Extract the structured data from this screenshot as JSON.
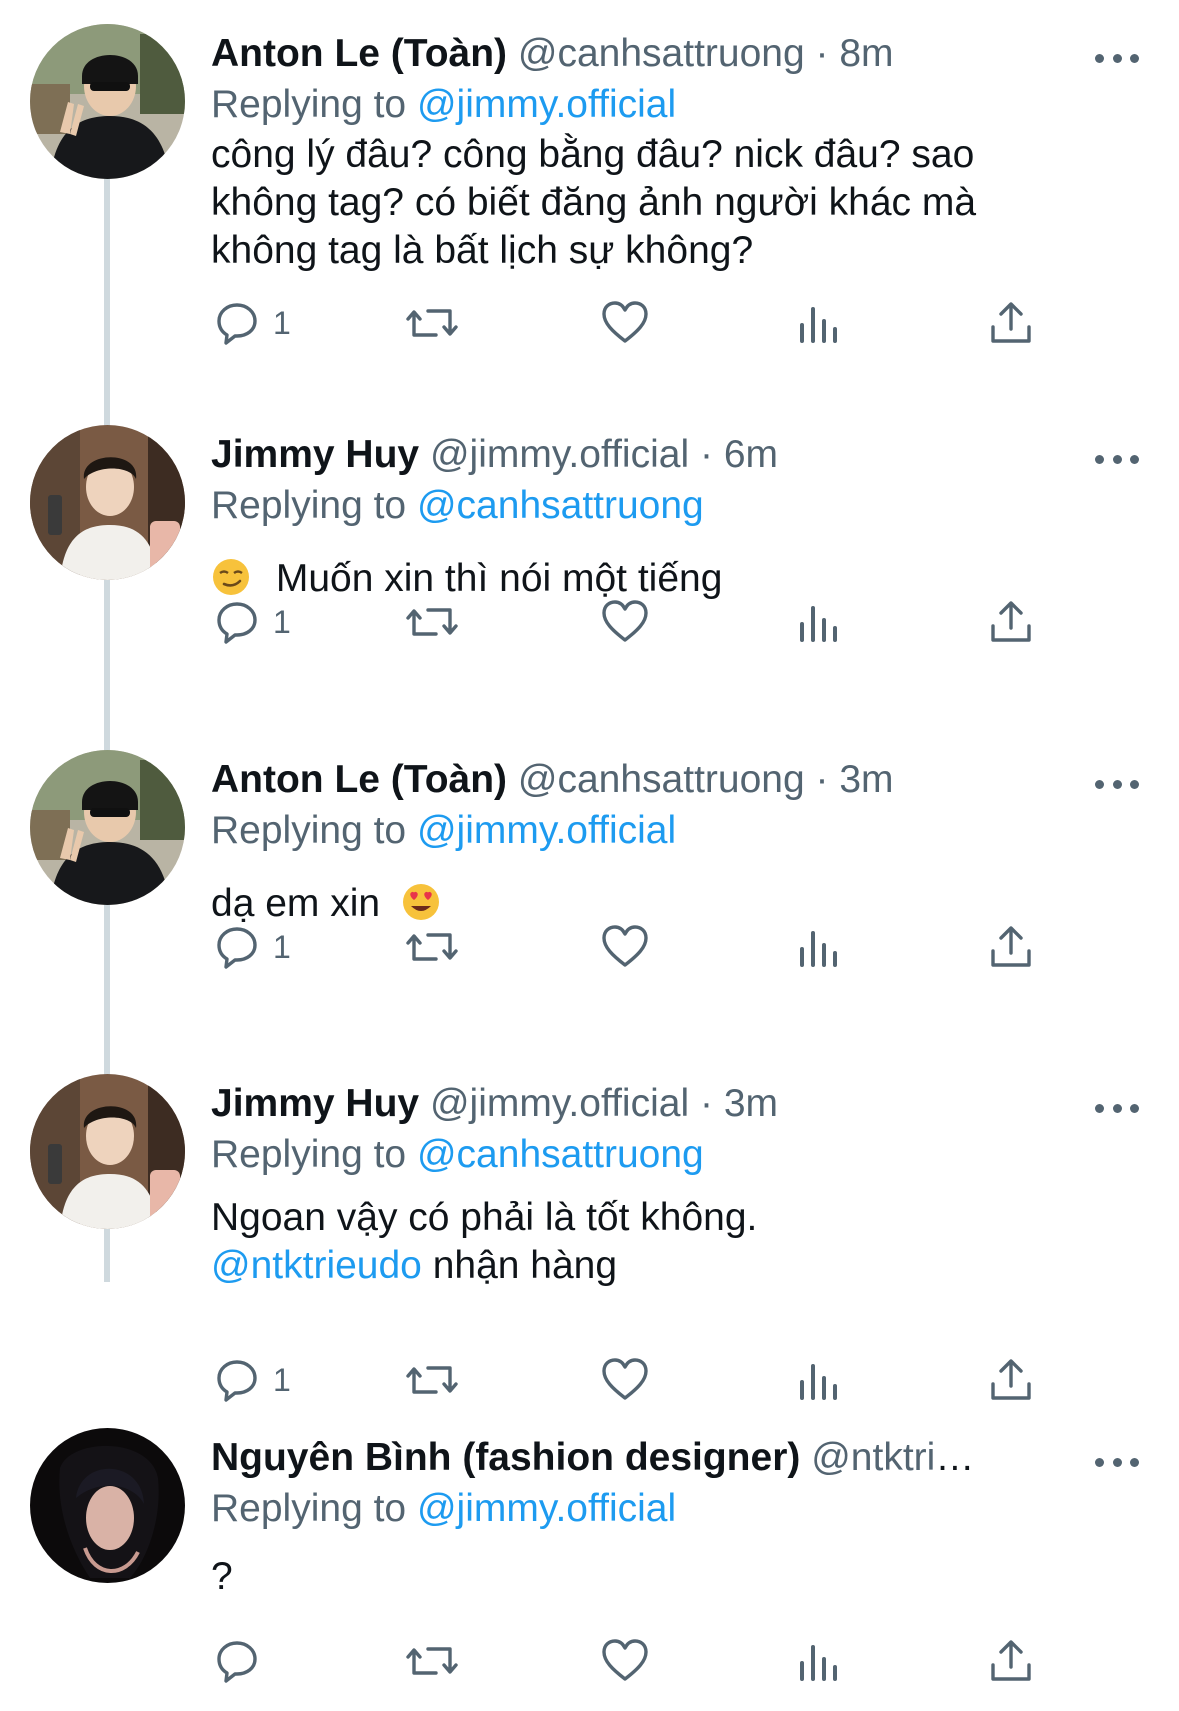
{
  "tweets": [
    {
      "name": "Anton Le (Toàn)",
      "handle": "@canhsattruong",
      "separator": "·",
      "time": "8m",
      "replying_prefix": "Replying to",
      "replying_to": "@jimmy.official",
      "body_text": "công lý đâu? công bằng đâu? nick đâu? sao không tag? có biết đăng ảnh người khác mà không tag là bất lịch sự không?",
      "reply_count": "1",
      "avatar": "avatar-anton"
    },
    {
      "name": "Jimmy Huy",
      "handle": "@jimmy.official",
      "separator": "·",
      "time": "6m",
      "replying_prefix": "Replying to",
      "replying_to": "@canhsattruong",
      "body_emoji": "smirk-emoji",
      "body_text": "Muốn xin thì nói một tiếng",
      "reply_count": "1",
      "avatar": "avatar-jimmy"
    },
    {
      "name": "Anton Le (Toàn)",
      "handle": "@canhsattruong",
      "separator": "·",
      "time": "3m",
      "replying_prefix": "Replying to",
      "replying_to": "@jimmy.official",
      "body_text": "dạ em xin",
      "body_emoji_after": "heart-eyes-emoji",
      "reply_count": "1",
      "avatar": "avatar-anton"
    },
    {
      "name": "Jimmy Huy",
      "handle": "@jimmy.official",
      "separator": "·",
      "time": "3m",
      "replying_prefix": "Replying to",
      "replying_to": "@canhsattruong",
      "body_line1": "Ngoan vậy có phải là tốt không.",
      "body_mention": "@ntktrieudo",
      "body_line2_rest": " nhận hàng",
      "reply_count": "1",
      "avatar": "avatar-jimmy"
    },
    {
      "name": "Nguyên Bình (fashion designer)",
      "handle": "@ntktrieu...",
      "replying_prefix": "Replying to",
      "replying_to": "@jimmy.official",
      "body_text": "?",
      "reply_count": "",
      "avatar": "avatar-nguyen"
    }
  ],
  "action_icons": [
    "reply-icon",
    "retweet-icon",
    "like-icon",
    "views-icon",
    "share-icon"
  ],
  "colors": {
    "text": "#0f1419",
    "secondary": "#536471",
    "mention": "#1d9bf0",
    "thread_line": "#cfd9de"
  }
}
